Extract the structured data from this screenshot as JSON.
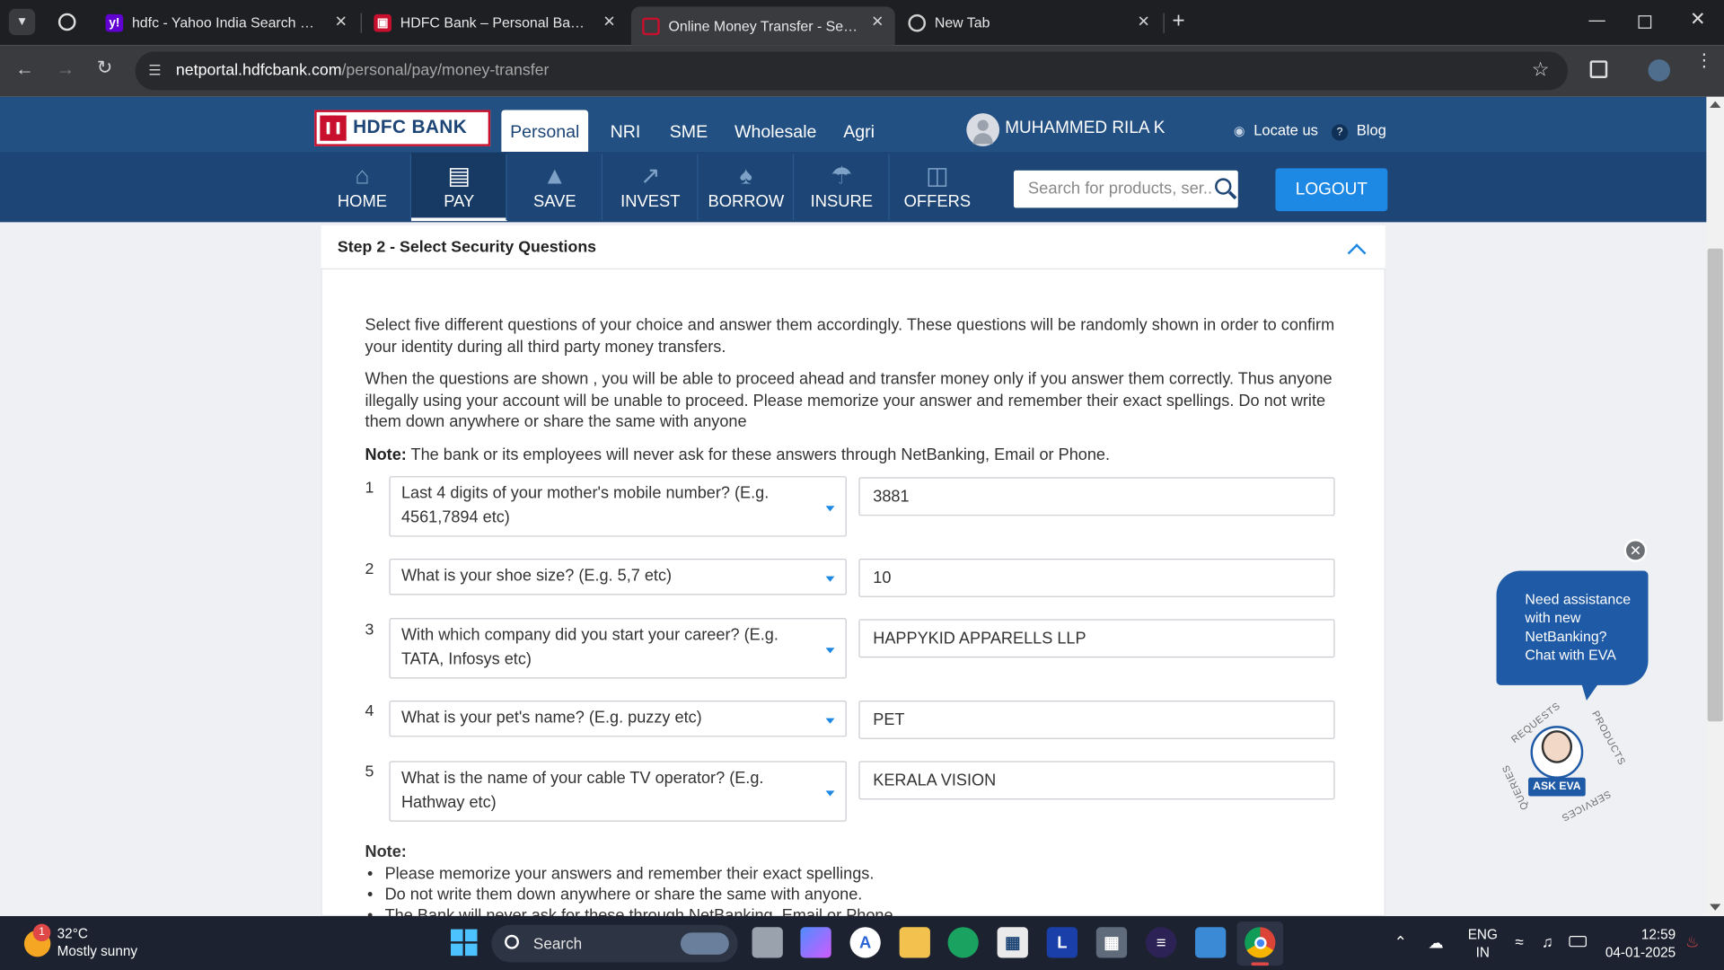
{
  "browser": {
    "tabs": [
      {
        "title": "hdfc - Yahoo India Search Resul",
        "favicon": "yahoo-icon"
      },
      {
        "title": "HDFC Bank – Personal Banking",
        "favicon": "hdfc-icon"
      },
      {
        "title": "Online Money Transfer - Send &",
        "favicon": "hdfc-icon"
      },
      {
        "title": "New Tab",
        "favicon": "globe-icon"
      }
    ],
    "active_tab_index": 2,
    "url_host": "netportal.hdfcbank.com",
    "url_path": "/personal/pay/money-transfer"
  },
  "header": {
    "logo_text": "HDFC BANK",
    "segments": [
      "Personal",
      "NRI",
      "SME",
      "Wholesale",
      "Agri"
    ],
    "user_name": "MUHAMMED RILA K",
    "locate": "Locate us",
    "blog": "Blog",
    "menu": [
      "HOME",
      "PAY",
      "SAVE",
      "INVEST",
      "BORROW",
      "INSURE",
      "OFFERS"
    ],
    "active_menu": "PAY",
    "search_placeholder": "Search for products, ser...",
    "logout": "LOGOUT"
  },
  "step": {
    "title": "Step 2 - Select Security Questions",
    "para1": "Select five different questions of your choice and answer them accordingly. These questions will be randomly shown in order to confirm your identity during all third party money transfers.",
    "para2": "When the questions are shown , you will be able to proceed ahead and transfer money only if you answer them correctly. Thus anyone illegally using your account will be unable to proceed. Please memorize your answer and remember their exact spellings. Do not write them down anywhere or share the same with anyone",
    "note_label": "Note:",
    "note_text": "The bank or its employees will never ask for these answers through NetBanking, Email or Phone.",
    "questions": [
      {
        "num": "1",
        "question": "Last 4 digits of your mother's mobile number? (E.g. 4561,7894 etc)",
        "answer": "3881"
      },
      {
        "num": "2",
        "question": "What is your shoe size? (E.g. 5,7 etc)",
        "answer": "10"
      },
      {
        "num": "3",
        "question": "With which company did you start your career? (E.g. TATA, Infosys etc)",
        "answer": "HAPPYKID APPARELLS LLP"
      },
      {
        "num": "4",
        "question": "What is your pet's name? (E.g. puzzy etc)",
        "answer": "PET"
      },
      {
        "num": "5",
        "question": "What is the name of your cable TV operator? (E.g. Hathway etc)",
        "answer": "KERALA VISION"
      }
    ],
    "note2_label": "Note:",
    "note2_items": [
      "Please memorize your answers and remember their exact spellings.",
      "Do not write them down anywhere or share the same with anyone.",
      "The Bank will never ask for these through NetBanking, Email or Phone."
    ]
  },
  "eva": {
    "bubble": "Need assistance with new NetBanking? Chat with EVA",
    "button": "ASK EVA",
    "ring": [
      "REQUESTS",
      "PRODUCTS",
      "SERVICES",
      "QUERIES"
    ]
  },
  "taskbar": {
    "weather_temp": "32°C",
    "weather_desc": "Mostly sunny",
    "weather_badge": "1",
    "search": "Search",
    "lang1": "ENG",
    "lang2": "IN",
    "time": "12:59",
    "date": "04-01-2025",
    "pinned": [
      "file-explorer-icon",
      "copilot-icon",
      "a-app-icon",
      "folder-icon",
      "edge-icon",
      "store-icon",
      "l-app-icon",
      "calculator-icon",
      "eclipse-icon",
      "monitor-icon",
      "chrome-icon"
    ]
  },
  "colors": {
    "brand_blue": "#1d4576",
    "accent_blue": "#1e88e5",
    "hdfc_red": "#c8102e"
  }
}
